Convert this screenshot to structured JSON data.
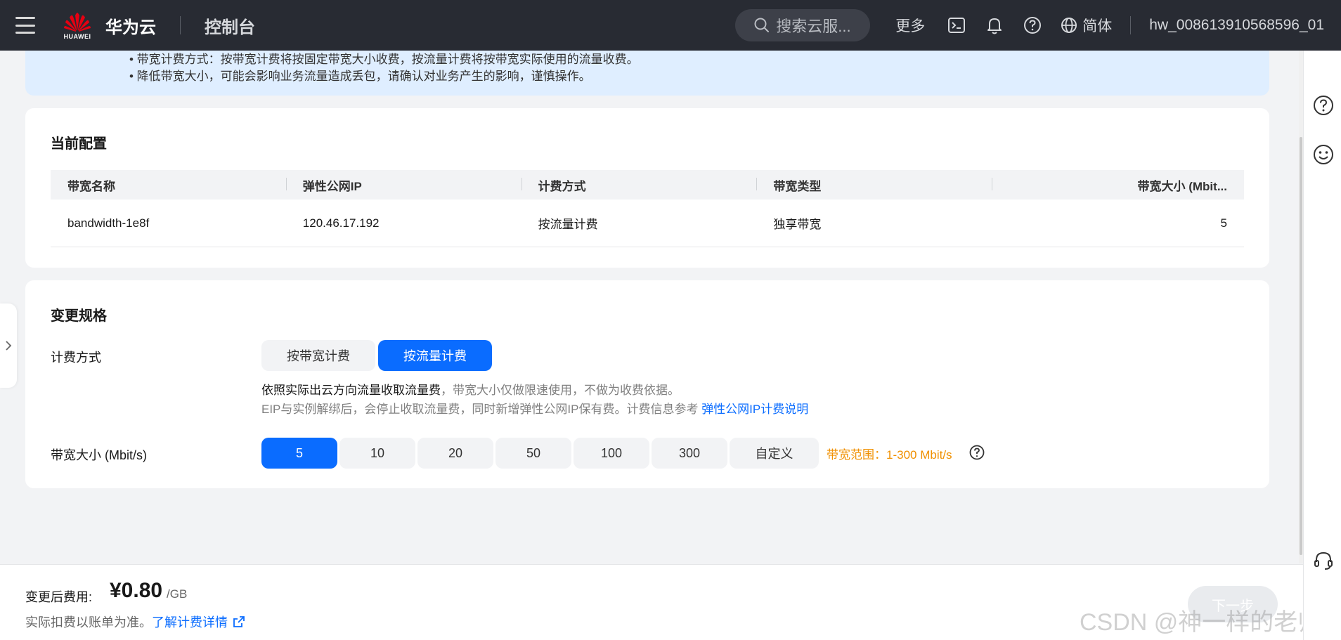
{
  "header": {
    "brand_logo_text": "HUAWEI",
    "brand": "华为云",
    "console": "控制台",
    "search_placeholder": "搜索云服...",
    "more": "更多",
    "language": "简体",
    "username": "hw_008613910568596_01"
  },
  "notice": {
    "lines": [
      "• 带宽计费方式：按带宽计费将按固定带宽大小收费，按流量计费将按带宽实际使用的流量收费。",
      "• 降低带宽大小，可能会影响业务流量造成丢包，请确认对业务产生的影响，谨慎操作。"
    ]
  },
  "current_config": {
    "title": "当前配置",
    "columns": [
      "带宽名称",
      "弹性公网IP",
      "计费方式",
      "带宽类型",
      "带宽大小 (Mbit..."
    ],
    "row": [
      "bandwidth-1e8f",
      "120.46.17.192",
      "按流量计费",
      "独享带宽",
      "5"
    ]
  },
  "change_spec": {
    "title": "变更规格",
    "billing_label": "计费方式",
    "billing_options": [
      "按带宽计费",
      "按流量计费"
    ],
    "billing_selected": "按流量计费",
    "desc_strong": "依照实际出云方向流量收取流量费",
    "desc_rest": "，带宽大小仅做限速使用，不做为收费依据。",
    "desc_line2": "EIP与实例解绑后，会停止收取流量费，同时新增弹性公网IP保有费。计费信息参考 ",
    "desc_link": "弹性公网IP计费说明",
    "bandwidth_label": "带宽大小 (Mbit/s)",
    "bandwidth_options": [
      "5",
      "10",
      "20",
      "50",
      "100",
      "300",
      "自定义"
    ],
    "bandwidth_selected": "5",
    "bandwidth_range": "带宽范围：1-300 Mbit/s"
  },
  "footer": {
    "fee_label": "变更后费用:",
    "fee_value": "¥0.80",
    "fee_unit": "/GB",
    "note": "实际扣费以账单为准。",
    "note_link": "了解计费详情",
    "next": "下一步",
    "watermark": "CSDN @神一样的老师"
  },
  "colors": {
    "topbar": "#282b33",
    "primary": "#0a6cff",
    "notice_bg": "#dfeeff",
    "warning_text": "#f09000"
  }
}
